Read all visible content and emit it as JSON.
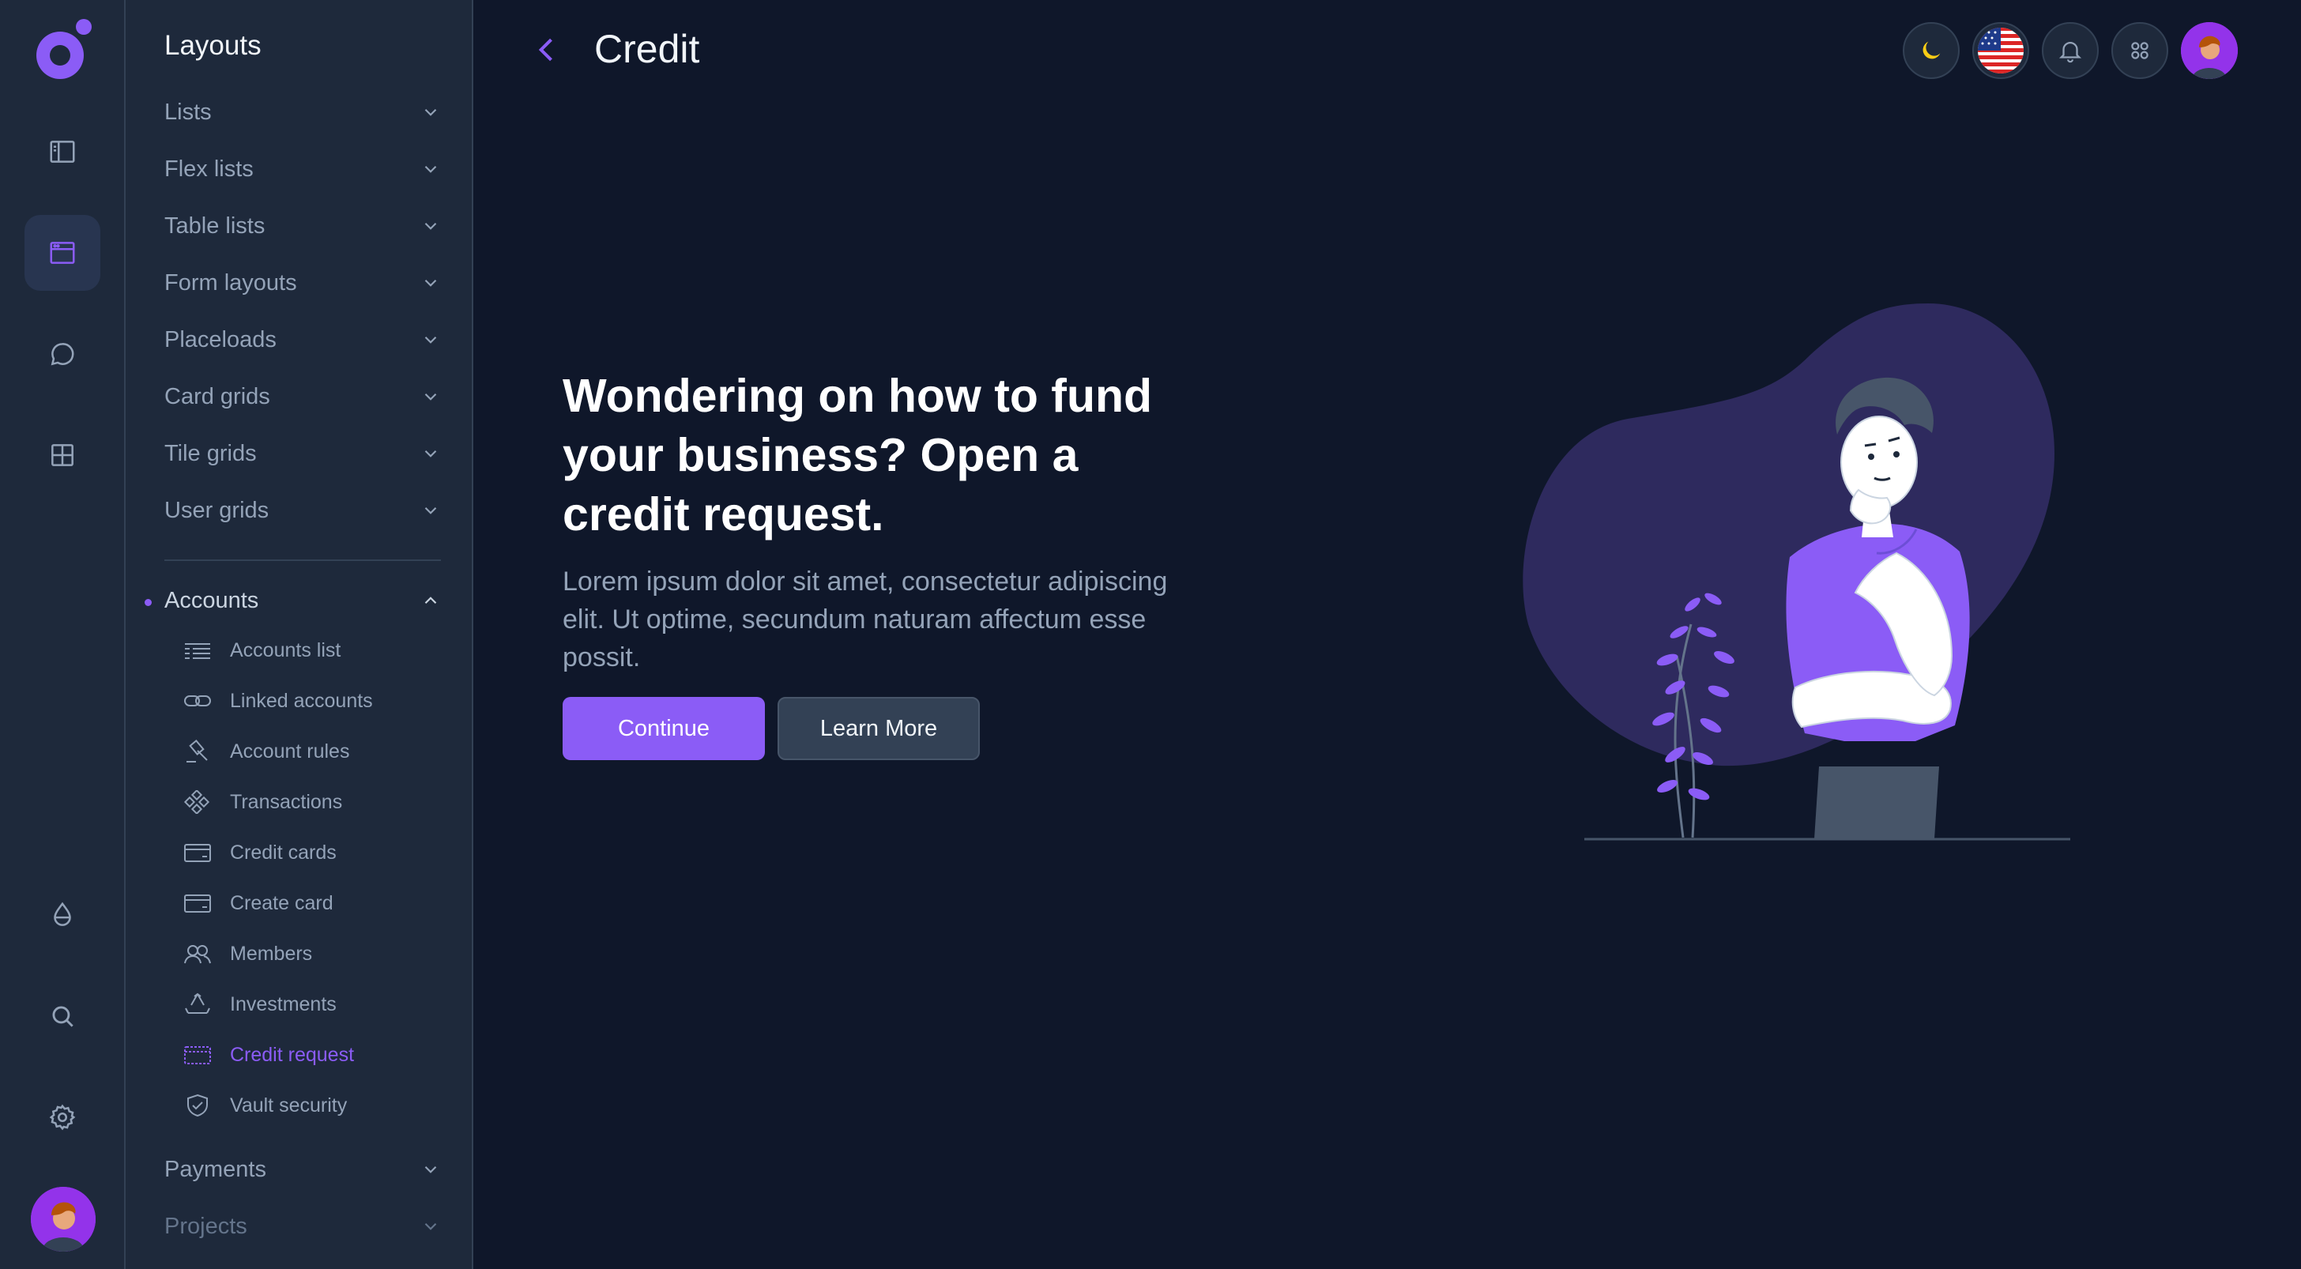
{
  "panel": {
    "title": "Layouts",
    "menu": [
      {
        "label": "Lists"
      },
      {
        "label": "Flex lists"
      },
      {
        "label": "Table lists"
      },
      {
        "label": "Form layouts"
      },
      {
        "label": "Placeloads"
      },
      {
        "label": "Card grids"
      },
      {
        "label": "Tile grids"
      },
      {
        "label": "User grids"
      }
    ],
    "accounts": {
      "label": "Accounts",
      "items": [
        {
          "label": "Accounts list",
          "icon": "list-icon"
        },
        {
          "label": "Linked accounts",
          "icon": "link-icon"
        },
        {
          "label": "Account rules",
          "icon": "gavel-icon"
        },
        {
          "label": "Transactions",
          "icon": "transactions-icon"
        },
        {
          "label": "Credit cards",
          "icon": "credit-card-icon"
        },
        {
          "label": "Create card",
          "icon": "card-icon"
        },
        {
          "label": "Members",
          "icon": "members-icon"
        },
        {
          "label": "Investments",
          "icon": "recycle-icon"
        },
        {
          "label": "Credit request",
          "icon": "credit-request-icon",
          "active": true
        },
        {
          "label": "Vault security",
          "icon": "shield-icon"
        }
      ]
    },
    "bottom_menu": [
      {
        "label": "Payments"
      },
      {
        "label": "Projects"
      }
    ]
  },
  "header": {
    "title": "Credit"
  },
  "hero": {
    "title": "Wondering on how to fund your business? Open a credit request.",
    "text": "Lorem ipsum dolor sit amet, consectetur adipiscing elit. Ut optime, secundum naturam affectum esse possit.",
    "primary_button": "Continue",
    "secondary_button": "Learn More"
  },
  "colors": {
    "accent": "#8b5cf6",
    "background": "#0f172a",
    "sidebar": "#1e293b"
  }
}
